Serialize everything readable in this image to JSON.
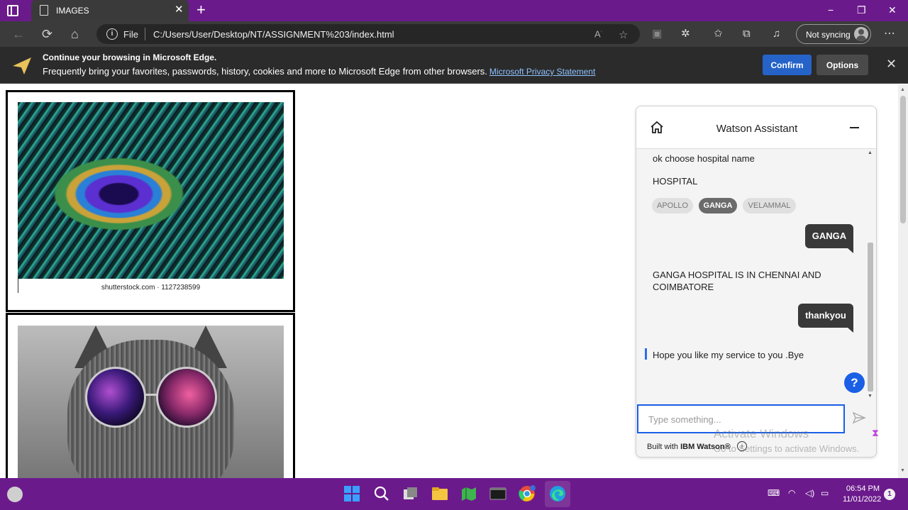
{
  "browser": {
    "tab_title": "IMAGES",
    "url_protocol": "File",
    "url": "C:/Users/User/Desktop/NT/ASSIGNMENT%203/index.html",
    "sync_label": "Not syncing",
    "minimize_glyph": "−",
    "restore_glyph": "❐",
    "close_glyph": "✕",
    "new_tab_glyph": "+",
    "tab_close_glyph": "✕"
  },
  "infobar": {
    "title": "Continue your browsing in Microsoft Edge.",
    "body": "Frequently bring your favorites, passwords, history, cookies and more to Microsoft Edge from other browsers.",
    "link": "Microsoft Privacy Statement",
    "confirm": "Confirm",
    "options": "Options",
    "close_glyph": "✕"
  },
  "page": {
    "image1_caption": "shutterstock.com · 1127238599"
  },
  "watson": {
    "title": "Watson Assistant",
    "messages": {
      "bot1": "ok choose hospital name",
      "bot2": "HOSPITAL",
      "options": [
        "APOLLO",
        "GANGA",
        "VELAMMAL"
      ],
      "user1": "GANGA",
      "bot3": "GANGA HOSPITAL IS IN CHENNAI AND COIMBATORE",
      "user2": "thankyou",
      "bot4": "Hope you like my service to you .Bye"
    },
    "help": "?",
    "input_placeholder": "Type something...",
    "footer_prefix": "Built with ",
    "footer_brand": "IBM Watson®",
    "footer_info": "i"
  },
  "watermark": {
    "line1": "Activate Windows",
    "line2": "Go to Settings to activate Windows."
  },
  "taskbar": {
    "time": "06:54 PM",
    "date": "11/01/2022",
    "notifications": "1"
  },
  "colors": {
    "accent_purple": "#6b1a8c",
    "watson_blue": "#1a5fe6",
    "confirm_blue": "#2563c9"
  }
}
